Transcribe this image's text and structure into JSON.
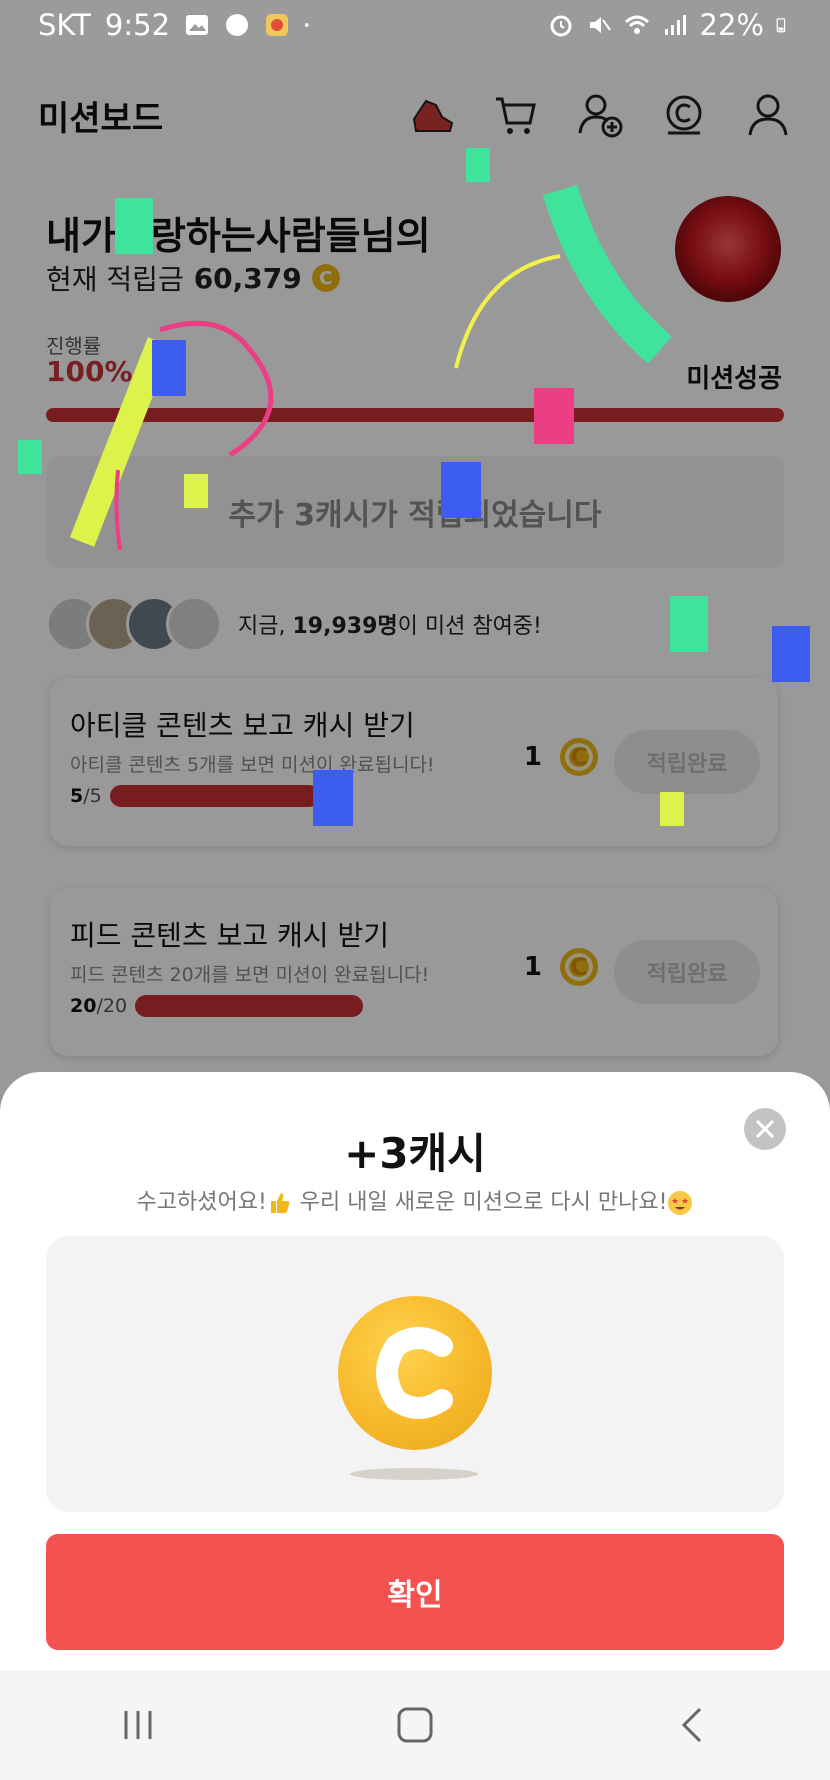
{
  "status_bar": {
    "carrier": "SKT",
    "time": "9:52",
    "battery": "22%"
  },
  "header": {
    "title": "미션보드",
    "icons": [
      "shoe-icon",
      "cart-icon",
      "add-friend-icon",
      "coin-history-icon",
      "profile-icon"
    ]
  },
  "user": {
    "greeting": "내가사랑하는사람들님의",
    "balance_label": "현재 적립금",
    "balance": "60,379",
    "coin_symbol": "C"
  },
  "progress": {
    "label": "진행률",
    "percent_text": "100%",
    "fill_percent": 100,
    "status": "미션성공"
  },
  "notice": {
    "text": "추가 3캐시가 적립되었습니다"
  },
  "participants": {
    "prefix": "지금,",
    "count": "19,939명",
    "suffix": "이 미션 참여중!"
  },
  "missions": [
    {
      "title": "아티클 콘텐츠 보고 캐시 받기",
      "desc": "아티클 콘텐츠 5개를 보면 미션이 완료됩니다!",
      "done": "5",
      "total": "/5",
      "reward": "1",
      "button": "적립완료"
    },
    {
      "title": "피드 콘텐츠 보고 캐시 받기",
      "desc": "피드 콘텐츠 20개를 보면 미션이 완료됩니다!",
      "done": "20",
      "total": "/20",
      "reward": "1",
      "button": "적립완료"
    }
  ],
  "sheet": {
    "title": "+3캐시",
    "subtitle_a": "수고하셨어요!",
    "subtitle_b": " 우리 내일 새로운 미션으로 다시 만나요!",
    "confirm": "확인"
  },
  "colors": {
    "accent_red": "#f45151",
    "progress_red": "#c62f35",
    "coin_gold": "#f2b817"
  }
}
